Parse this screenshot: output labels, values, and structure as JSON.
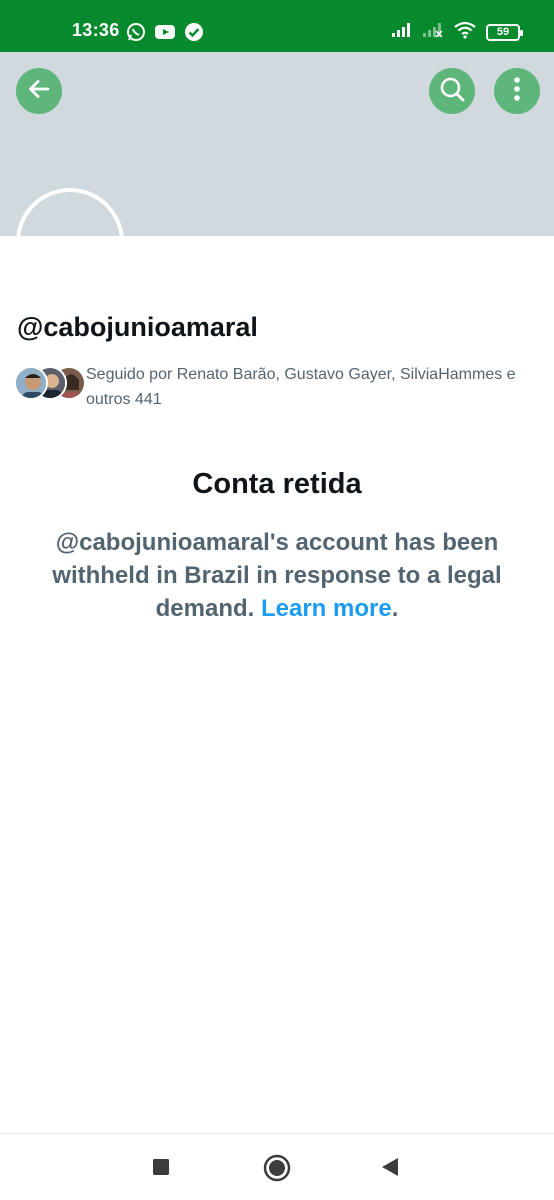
{
  "status_bar": {
    "time": "13:36",
    "battery": "59",
    "background": "#078a2e",
    "left_icons": [
      "whatsapp-icon",
      "youtube-icon",
      "check-circle-icon"
    ],
    "right_icons": [
      "signal-icon",
      "signal-off-icon",
      "wifi-icon",
      "battery-icon"
    ]
  },
  "header": {
    "banner_color": "#cfd9de",
    "button_color": "#5fb67b",
    "buttons": [
      "back-arrow-icon",
      "search-icon",
      "more-vertical-icon"
    ]
  },
  "profile": {
    "handle": "@cabojunioamaral",
    "followed_by": "Seguido por Renato Barão, Gustavo Gayer, SilviaHammes e outros 441"
  },
  "withheld": {
    "title": "Conta retida",
    "message": "@cabojunioamaral's account has been withheld in Brazil in response to a legal demand.",
    "learn_more": "Learn more",
    "period": ".",
    "link_color": "#1d9bf0"
  },
  "nav_bar": {
    "buttons": [
      "recents-square-icon",
      "home-circle-icon",
      "back-triangle-icon"
    ]
  }
}
